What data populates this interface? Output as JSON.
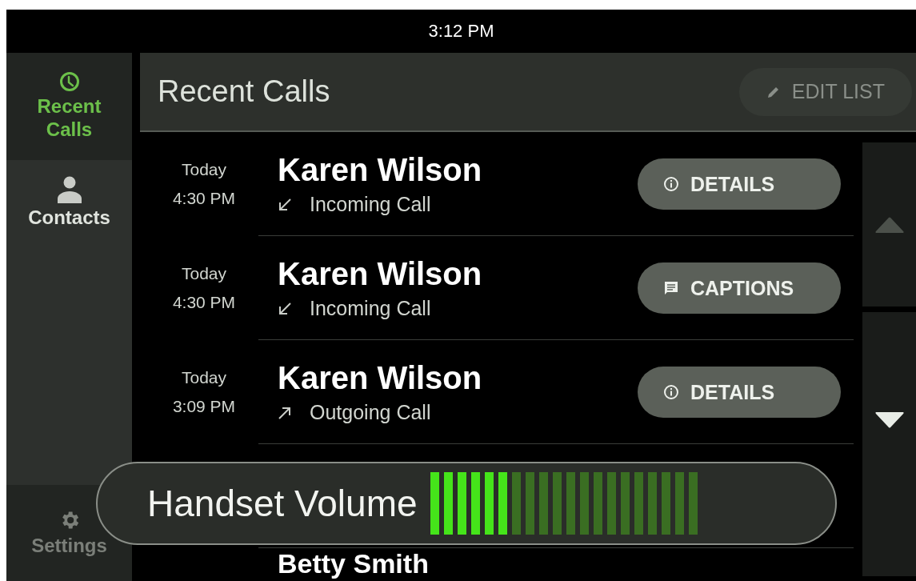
{
  "status_bar": {
    "time": "3:12 PM"
  },
  "sidebar": {
    "items": [
      {
        "label": "Recent Calls",
        "kind": "clock",
        "selected": true,
        "disabled": false
      },
      {
        "label": "Contacts",
        "kind": "person",
        "selected": false,
        "disabled": false
      },
      {
        "label": "Settings",
        "kind": "gear",
        "selected": false,
        "disabled": true
      }
    ]
  },
  "header": {
    "title": "Recent Calls",
    "edit_button": "EDIT LIST"
  },
  "calls": [
    {
      "day": "Today",
      "time": "4:30 PM",
      "name": "Karen Wilson",
      "kind": "incoming",
      "type": "Incoming Call",
      "action": {
        "kind": "details",
        "label": "DETAILS"
      }
    },
    {
      "day": "Today",
      "time": "4:30 PM",
      "name": "Karen Wilson",
      "kind": "incoming",
      "type": "Incoming Call",
      "action": {
        "kind": "captions",
        "label": "CAPTIONS"
      }
    },
    {
      "day": "Today",
      "time": "3:09 PM",
      "name": "Karen Wilson",
      "kind": "outgoing",
      "type": "Outgoing Call",
      "action": {
        "kind": "details",
        "label": "DETAILS"
      }
    }
  ],
  "partial_call": {
    "name": "Betty Smith"
  },
  "volume": {
    "label": "Handset Volume",
    "level": 0.3
  }
}
